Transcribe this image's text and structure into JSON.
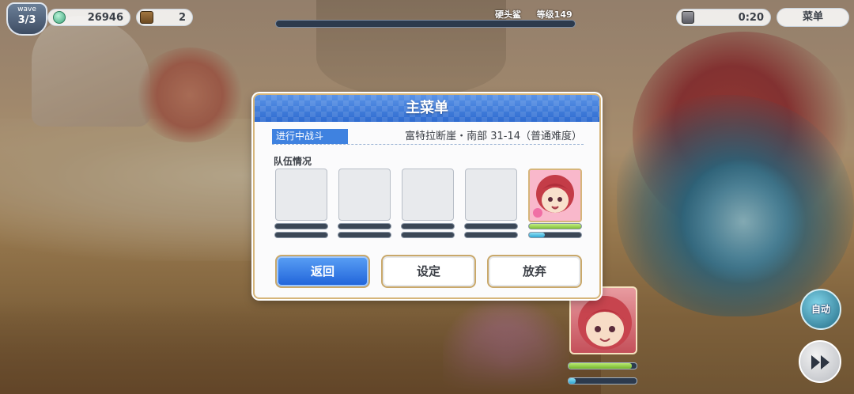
{
  "hud": {
    "wave_label": "wave",
    "wave_value": "3/3",
    "coins": "26946",
    "chests": "2",
    "boss_name": "硬头鲨",
    "boss_level": "等级149",
    "timer": "0:20",
    "menu_label": "菜单",
    "auto_label": "自动",
    "player_hp_fraction": 0.93,
    "player_tp_fraction": 0.1
  },
  "dialog": {
    "title": "主菜单",
    "battle_tag": "进行中战斗",
    "battle_location": "富特拉断崖・南部 31-14（普通难度）",
    "team_label": "队伍情况",
    "member_hp_fraction": 1.0,
    "member_tp_fraction": 0.3,
    "buttons": {
      "back": "返回",
      "settings": "设定",
      "give_up": "放弃"
    }
  },
  "icons": {
    "coin": "coin-icon",
    "chest": "chest-icon",
    "timer": "hourglass-icon",
    "fast_forward": "fast-forward-icon"
  },
  "colors": {
    "dialog_header": "#2e6bd0",
    "primary_button": "#1f62d9",
    "hp_green": "#7fbf37",
    "tp_blue": "#2fa6d3",
    "gold_border": "#c9a86a"
  }
}
